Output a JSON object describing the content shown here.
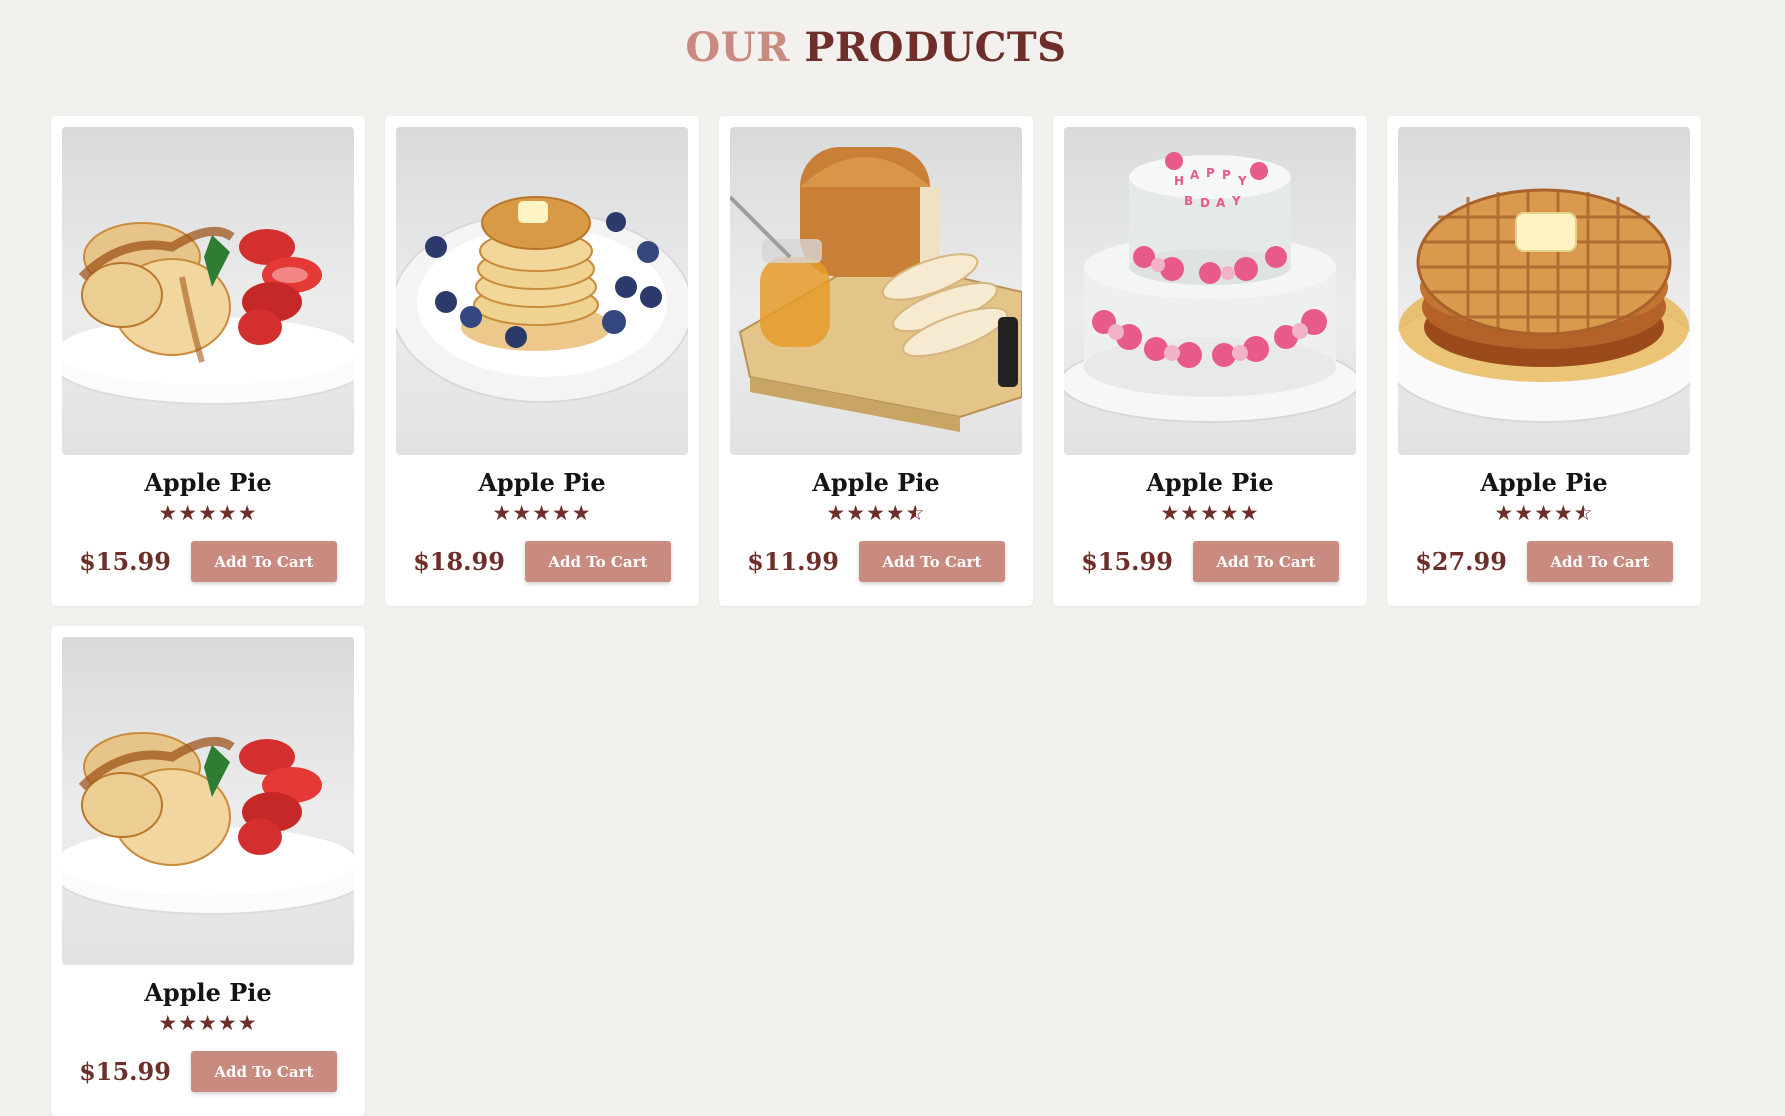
{
  "heading": {
    "word1": "OUR",
    "word2": "PRODUCTS"
  },
  "colors": {
    "accent": "#c98b80",
    "brand": "#6e2f2a",
    "background": "#f2f1ed"
  },
  "products": [
    {
      "name": "Apple Pie",
      "price": "$15.99",
      "rating": 5,
      "button": "Add To Cart",
      "image": "pancakes-with-strawberries"
    },
    {
      "name": "Apple Pie",
      "price": "$18.99",
      "rating": 5,
      "button": "Add To Cart",
      "image": "pancake-stack-with-blueberries"
    },
    {
      "name": "Apple Pie",
      "price": "$11.99",
      "rating": 4.5,
      "button": "Add To Cart",
      "image": "bread-loaf-with-honey"
    },
    {
      "name": "Apple Pie",
      "price": "$15.99",
      "rating": 5,
      "button": "Add To Cart",
      "image": "birthday-cake-with-roses"
    },
    {
      "name": "Apple Pie",
      "price": "$27.99",
      "rating": 4.5,
      "button": "Add To Cart",
      "image": "waffles-with-butter"
    },
    {
      "name": "Apple Pie",
      "price": "$15.99",
      "rating": 5,
      "button": "Add To Cart",
      "image": "pancakes-with-strawberries"
    }
  ]
}
